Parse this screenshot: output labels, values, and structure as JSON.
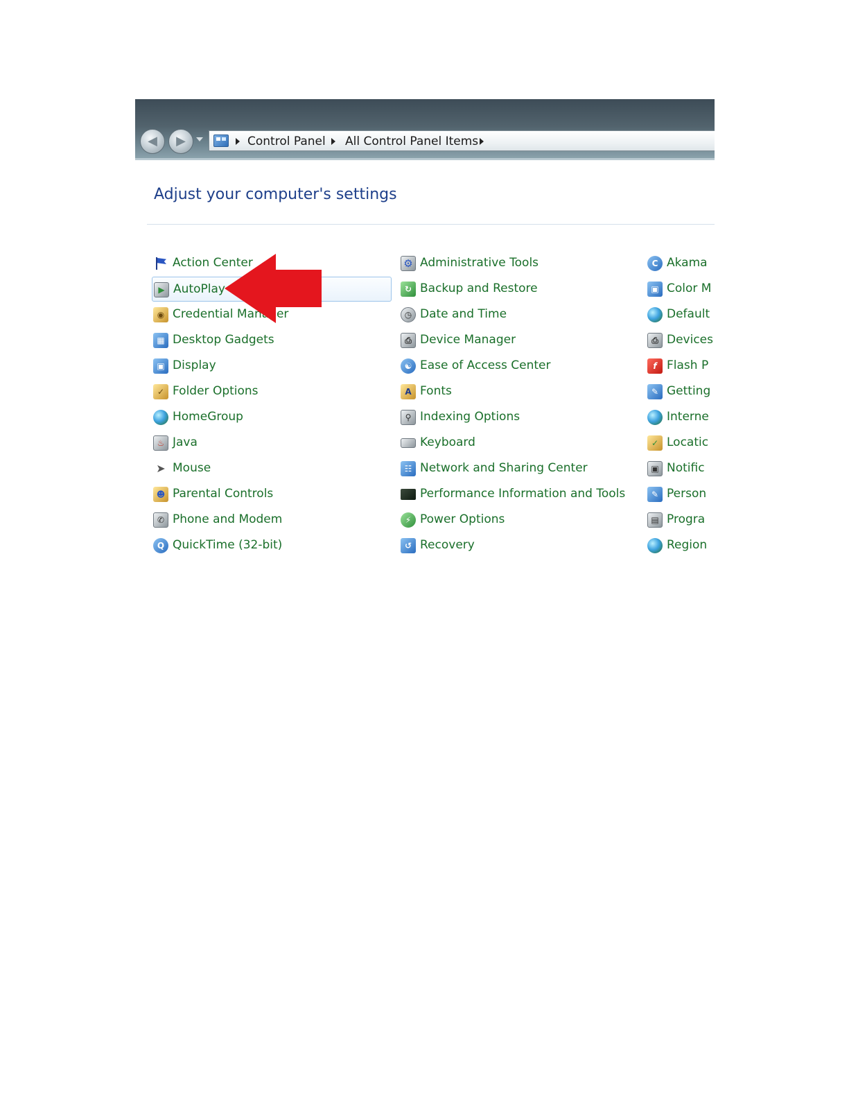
{
  "address_bar": {
    "crumbs": [
      "Control Panel",
      "All Control Panel Items"
    ]
  },
  "page_title": "Adjust your computer's settings",
  "columns": [
    [
      {
        "label": "Action Center",
        "icon": "flag-icon"
      },
      {
        "label": "AutoPlay",
        "icon": "autoplay-icon",
        "selected": true
      },
      {
        "label": "Credential Manager",
        "icon": "vault-icon"
      },
      {
        "label": "Desktop Gadgets",
        "icon": "gadgets-icon"
      },
      {
        "label": "Display",
        "icon": "monitor-icon"
      },
      {
        "label": "Folder Options",
        "icon": "folder-icon"
      },
      {
        "label": "HomeGroup",
        "icon": "homegroup-icon"
      },
      {
        "label": "Java",
        "icon": "java-icon"
      },
      {
        "label": "Mouse",
        "icon": "mouse-icon"
      },
      {
        "label": "Parental Controls",
        "icon": "family-icon"
      },
      {
        "label": "Phone and Modem",
        "icon": "phone-icon"
      },
      {
        "label": "QuickTime (32-bit)",
        "icon": "quicktime-icon"
      }
    ],
    [
      {
        "label": "Administrative Tools",
        "icon": "gear-icon"
      },
      {
        "label": "Backup and Restore",
        "icon": "backup-icon"
      },
      {
        "label": "Date and Time",
        "icon": "clock-icon"
      },
      {
        "label": "Device Manager",
        "icon": "printer-icon"
      },
      {
        "label": "Ease of Access Center",
        "icon": "accessibility-icon"
      },
      {
        "label": "Fonts",
        "icon": "fonts-icon"
      },
      {
        "label": "Indexing Options",
        "icon": "search-icon"
      },
      {
        "label": "Keyboard",
        "icon": "keyboard-icon"
      },
      {
        "label": "Network and Sharing Center",
        "icon": "network-icon"
      },
      {
        "label": "Performance Information and Tools",
        "icon": "performance-icon"
      },
      {
        "label": "Power Options",
        "icon": "power-icon"
      },
      {
        "label": "Recovery",
        "icon": "recovery-icon"
      }
    ],
    [
      {
        "label": "Akama",
        "icon": "akamai-icon"
      },
      {
        "label": "Color M",
        "icon": "color-management-icon"
      },
      {
        "label": "Default",
        "icon": "default-programs-icon"
      },
      {
        "label": "Devices",
        "icon": "devices-icon"
      },
      {
        "label": "Flash P",
        "icon": "flash-icon"
      },
      {
        "label": "Getting",
        "icon": "getting-started-icon"
      },
      {
        "label": "Interne",
        "icon": "internet-options-icon"
      },
      {
        "label": "Locatic",
        "icon": "location-icon"
      },
      {
        "label": "Notific",
        "icon": "notification-icon"
      },
      {
        "label": "Person",
        "icon": "personalization-icon"
      },
      {
        "label": "Progra",
        "icon": "programs-icon"
      },
      {
        "label": "Region",
        "icon": "region-icon"
      }
    ]
  ],
  "colors": {
    "link_green": "#1a6f2a",
    "title_blue": "#1e3f8a",
    "arrow_red": "#e4161e"
  }
}
